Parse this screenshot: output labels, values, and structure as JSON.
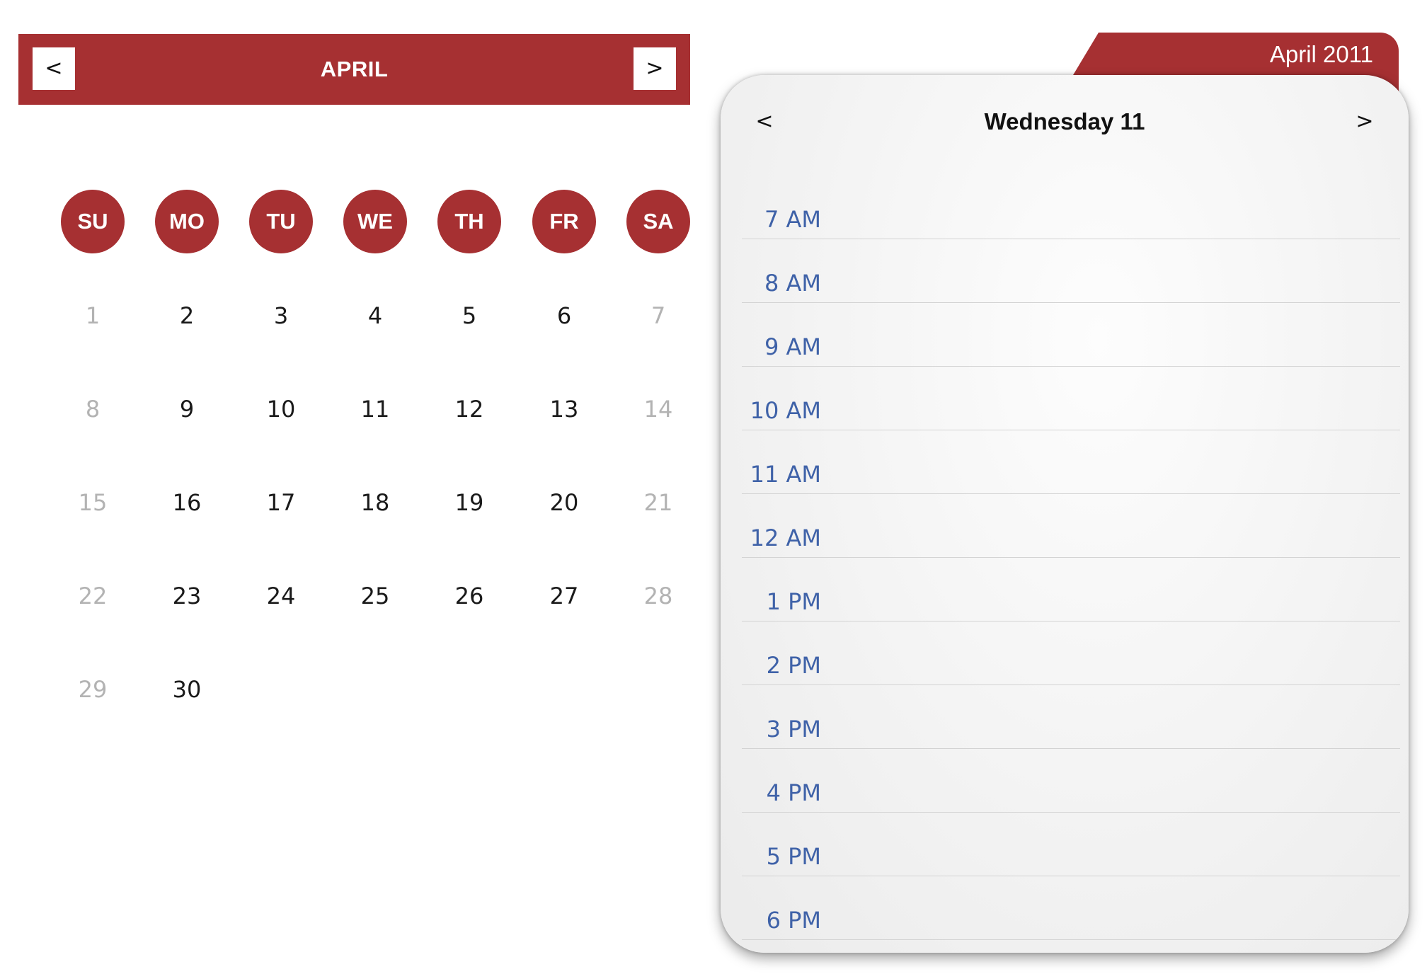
{
  "month_calendar": {
    "title": "APRIL",
    "prev_label": "<",
    "next_label": ">",
    "weekdays": [
      "SU",
      "MO",
      "TU",
      "WE",
      "TH",
      "FR",
      "SA"
    ],
    "weeks": [
      [
        "1",
        "2",
        "3",
        "4",
        "5",
        "6",
        "7"
      ],
      [
        "8",
        "9",
        "10",
        "11",
        "12",
        "13",
        "14"
      ],
      [
        "15",
        "16",
        "17",
        "18",
        "19",
        "20",
        "21"
      ],
      [
        "22",
        "23",
        "24",
        "25",
        "26",
        "27",
        "28"
      ],
      [
        "29",
        "30",
        "",
        "",
        "",
        "",
        ""
      ]
    ]
  },
  "day_view": {
    "tab_label": "April 2011",
    "title": "Wednesday 11",
    "prev_label": "<",
    "next_label": ">",
    "hours": [
      "7 AM",
      "8 AM",
      "9 AM",
      "10 AM",
      "11 AM",
      "12 AM",
      "1 PM",
      "2 PM",
      "3 PM",
      "4 PM",
      "5 PM",
      "6 PM"
    ]
  },
  "colors": {
    "accent": "#a63032",
    "hour_label": "#3f62a8",
    "weekend_day": "#b3b3b3",
    "weekday_day": "#1a1a1a"
  }
}
